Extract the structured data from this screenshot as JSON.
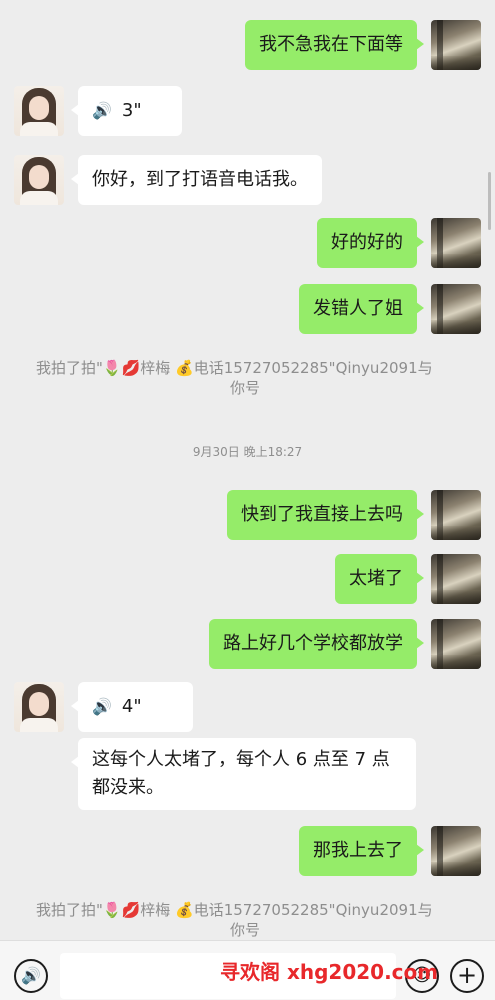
{
  "messages": {
    "m1": "我不急我在下面等",
    "m2_duration": "3\"",
    "m3": "你好，到了打语音电话我。",
    "m4": "好的好的",
    "m5": "发错人了姐",
    "sys1_line1": "我拍了拍\"🌷💋梓梅 💰电话15727052285\"Qinyu2091与",
    "sys1_line2": "你号",
    "timestamp": "9月30日 晚上18:27",
    "m6": "快到了我直接上去吗",
    "m7": "太堵了",
    "m8": "路上好几个学校都放学",
    "m9_duration": "4\"",
    "m10": "这每个人太堵了，每个人 6 点至 7 点都没来。",
    "m11": "那我上去了",
    "sys2_line1": "我拍了拍\"🌷💋梓梅 💰电话15727052285\"Qinyu2091与",
    "sys2_line2": "你号"
  },
  "icons": {
    "voice_wave": "🔊",
    "voice_button": "🔊",
    "emoji_button": "☺",
    "plus_button": "+"
  },
  "watermark": "寻欢阁 xhg2020.com",
  "colors": {
    "outgoing_bubble": "#95ec69",
    "incoming_bubble": "#ffffff",
    "background": "#ededed",
    "watermark": "#e8282b"
  }
}
